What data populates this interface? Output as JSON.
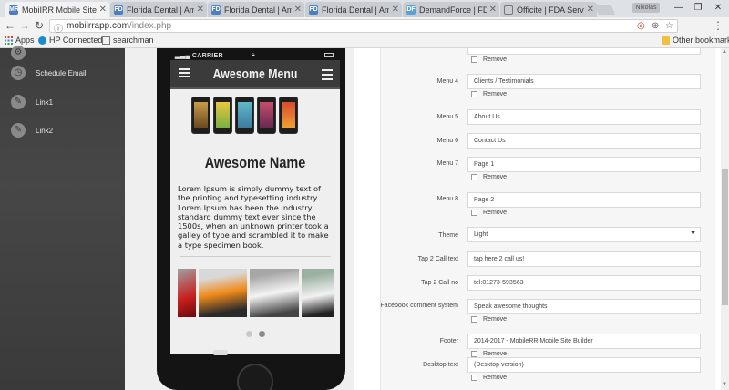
{
  "browser": {
    "tabs": [
      {
        "title": "MobiIRR Mobile Site B",
        "favicon": "MR",
        "active": true
      },
      {
        "title": "Florida Dental | Amer",
        "favicon": "FD"
      },
      {
        "title": "Florida Dental | Amer",
        "favicon": "FD"
      },
      {
        "title": "Florida Dental | Amer",
        "favicon": "FD"
      },
      {
        "title": "DemandForce | FDA Se",
        "favicon": "DF"
      },
      {
        "title": "Officite | FDA Services",
        "favicon": ""
      }
    ],
    "url": "mobilrrapp.com",
    "url_path": "/index.php",
    "bookmarks": [
      {
        "label": "Apps",
        "icon": "apps-grid-icon"
      },
      {
        "label": "HP Connected",
        "icon": "hp-logo-icon"
      },
      {
        "label": "searchman",
        "icon": "image-icon"
      }
    ],
    "other_bookmarks": "Other bookmarks",
    "user": "Nikolas"
  },
  "sidebar": {
    "items": [
      {
        "label": "",
        "icon": "gear-icon"
      },
      {
        "label": "Schedule Email",
        "icon": "clock-icon"
      },
      {
        "label": "Link1",
        "icon": "wrench-icon"
      },
      {
        "label": "Link2",
        "icon": "wrench-icon"
      }
    ]
  },
  "preview": {
    "carrier": "CARRIER",
    "app_title": "Awesome Menu",
    "name": "Awesome Name",
    "body": "Lorem Ipsum is simply dummy text of the printing and typesetting industry. Lorem Ipsum has been the industry standard dummy text ever since the 1500s, when an unknown printer took a galley of type and scrambled it to make a type specimen book.",
    "carousel_images": [
      "red-car-image",
      "orange-car-image",
      "white-car-image",
      "white-suv-image"
    ],
    "carousel_active": 1
  },
  "form": {
    "remove_label": "Remove",
    "rows": [
      {
        "label": "Menu 4",
        "value": "Clients / Testimonials",
        "remove": true
      },
      {
        "label": "Menu 5",
        "value": "About Us",
        "remove": false
      },
      {
        "label": "Menu 6",
        "value": "Contact Us",
        "remove": false
      },
      {
        "label": "Menu 7",
        "value": "Page 1",
        "remove": true
      },
      {
        "label": "Menu 8",
        "value": "Page 2",
        "remove": true
      },
      {
        "label": "Theme",
        "value": "Light",
        "remove": false,
        "select": true
      },
      {
        "label": "Tap 2 Call text",
        "value": "tap here 2 call us!",
        "remove": false
      },
      {
        "label": "Tap 2 Call no",
        "value": "tel:01273-593563",
        "remove": false
      },
      {
        "label": "Facebook comment system",
        "value": "Speak awesome thoughts",
        "remove": true
      },
      {
        "label": "Footer",
        "value": "2014-2017 - MobileRR Mobile Site Builder",
        "remove": true
      },
      {
        "label": "Desktop text",
        "value": "(Desktop version)",
        "remove": true
      }
    ]
  },
  "colors": {
    "sidebar": "#3e3e3e",
    "phone_header": "#3b3b3b",
    "panel": "#f6f6f6"
  }
}
